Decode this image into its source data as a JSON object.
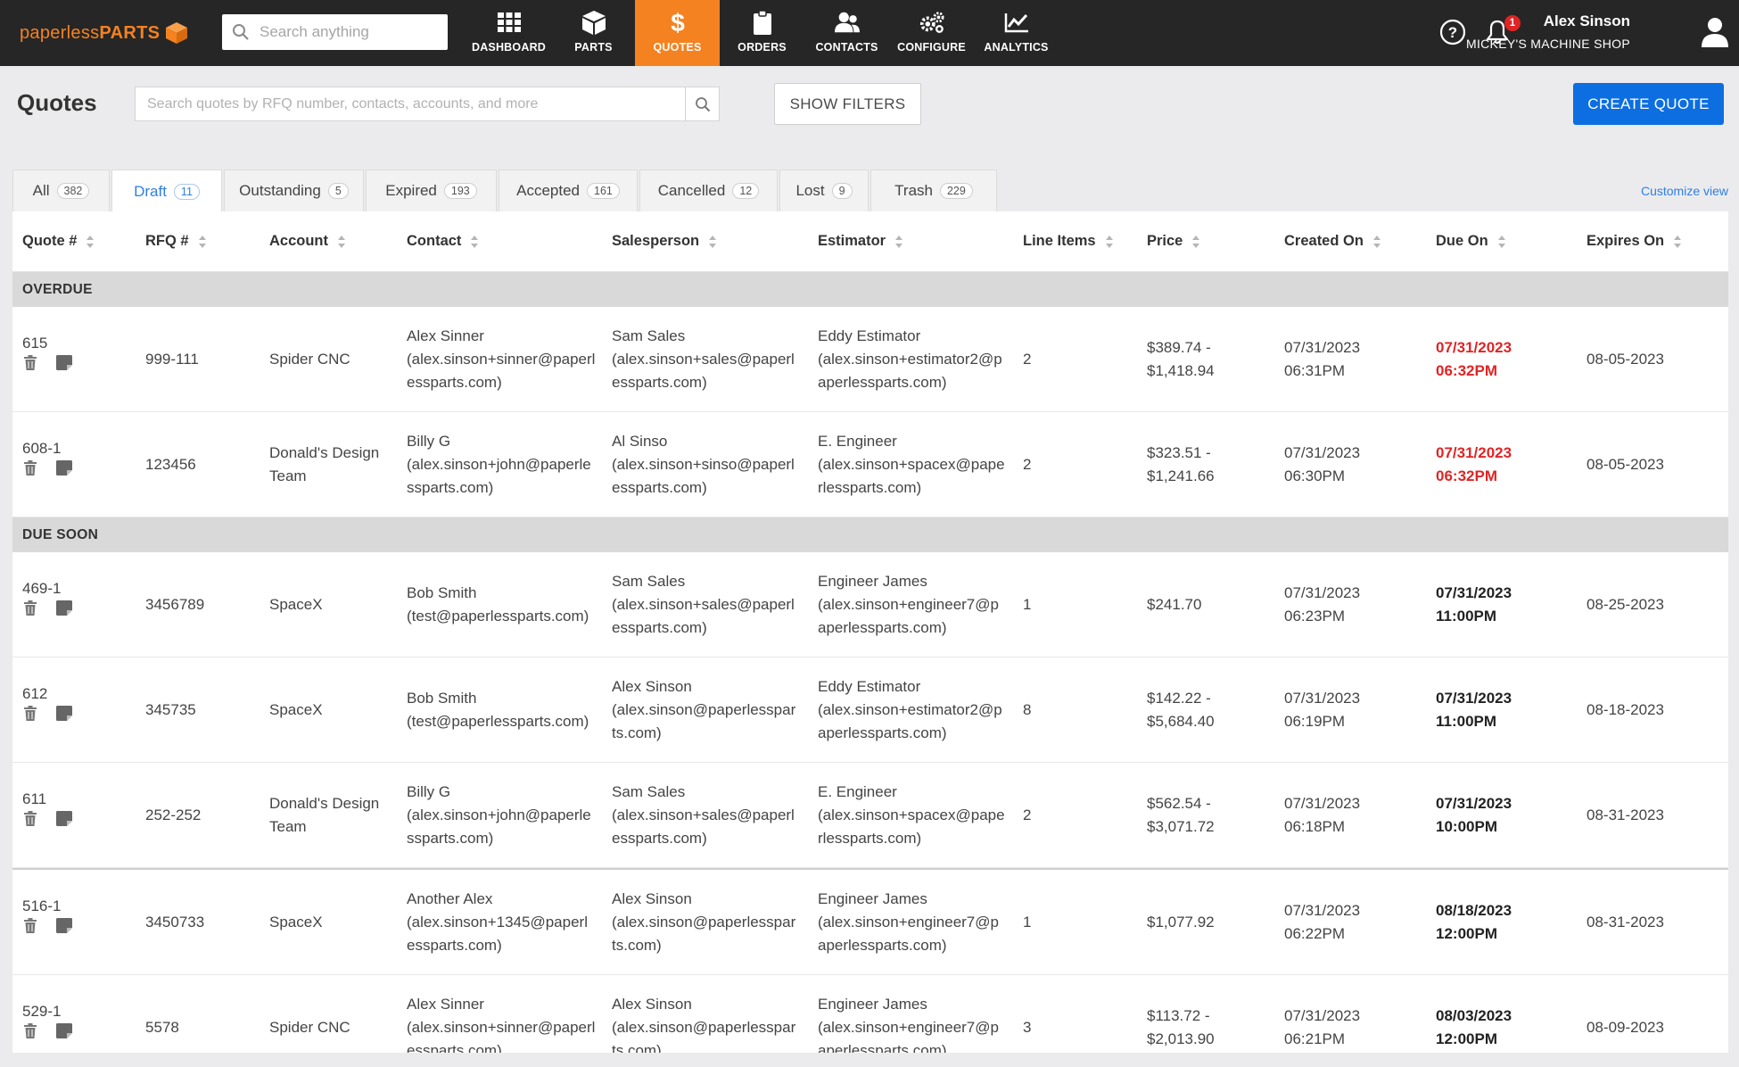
{
  "brand": {
    "name_light": "paperless",
    "name_bold": "PARTS",
    "accent": "#f58220"
  },
  "global_search": {
    "placeholder": "Search anything"
  },
  "nav": [
    {
      "key": "dashboard",
      "label": "DASHBOARD",
      "icon": "dashboard-grid-icon"
    },
    {
      "key": "parts",
      "label": "PARTS",
      "icon": "box-icon"
    },
    {
      "key": "quotes",
      "label": "QUOTES",
      "icon": "dollar-icon",
      "active": true
    },
    {
      "key": "orders",
      "label": "ORDERS",
      "icon": "clipboard-icon"
    },
    {
      "key": "contacts",
      "label": "CONTACTS",
      "icon": "people-icon"
    },
    {
      "key": "configure",
      "label": "CONFIGURE",
      "icon": "gears-icon"
    },
    {
      "key": "analytics",
      "label": "ANALYTICS",
      "icon": "line-chart-icon"
    }
  ],
  "notifications": {
    "count": "1"
  },
  "user": {
    "name": "Alex Sinson",
    "shop": "MICKEY'S MACHINE SHOP"
  },
  "page": {
    "title": "Quotes",
    "search_placeholder": "Search quotes by RFQ number, contacts, accounts, and more",
    "show_filters_label": "SHOW FILTERS",
    "create_quote_label": "CREATE QUOTE"
  },
  "tabs": [
    {
      "label": "All",
      "count": "382"
    },
    {
      "label": "Draft",
      "count": "11",
      "active": true
    },
    {
      "label": "Outstanding",
      "count": "5"
    },
    {
      "label": "Expired",
      "count": "193"
    },
    {
      "label": "Accepted",
      "count": "161"
    },
    {
      "label": "Cancelled",
      "count": "12"
    },
    {
      "label": "Lost",
      "count": "9"
    },
    {
      "label": "Trash",
      "count": "229"
    }
  ],
  "customize_view_label": "Customize view",
  "columns": {
    "quote": "Quote #",
    "rfq": "RFQ #",
    "account": "Account",
    "contact": "Contact",
    "salesperson": "Salesperson",
    "estimator": "Estimator",
    "line_items": "Line Items",
    "price": "Price",
    "created_on": "Created On",
    "due_on": "Due On",
    "expires_on": "Expires On"
  },
  "groups": {
    "overdue": "OVERDUE",
    "due_soon": "DUE SOON"
  },
  "rows": [
    {
      "quote": "615",
      "rfq": "999-111",
      "account": [
        "Spider CNC"
      ],
      "contact": [
        "Alex Sinner",
        "(alex.sinson+sinner@paperl",
        "essparts.com)"
      ],
      "salesperson": [
        "Sam Sales",
        "(alex.sinson+sales@paperl",
        "essparts.com)"
      ],
      "estimator": [
        "Eddy Estimator",
        "(alex.sinson+estimator2@p",
        "aperlessparts.com)"
      ],
      "line_items": "2",
      "price": [
        "$389.74 -",
        "$1,418.94"
      ],
      "created": [
        "07/31/2023",
        "06:31PM"
      ],
      "due": [
        "07/31/2023",
        "06:32PM"
      ],
      "due_style": "red",
      "expires": "08-05-2023"
    },
    {
      "quote": "608-1",
      "rfq": "123456",
      "account": [
        "Donald's Design",
        "Team"
      ],
      "contact": [
        "Billy G",
        "(alex.sinson+john@paperle",
        "ssparts.com)"
      ],
      "salesperson": [
        "Al Sinso",
        "(alex.sinson+sinso@paperl",
        "essparts.com)"
      ],
      "estimator": [
        "E. Engineer",
        "(alex.sinson+spacex@pape",
        "rlessparts.com)"
      ],
      "line_items": "2",
      "price": [
        "$323.51 -",
        "$1,241.66"
      ],
      "created": [
        "07/31/2023",
        "06:30PM"
      ],
      "due": [
        "07/31/2023",
        "06:32PM"
      ],
      "due_style": "red",
      "expires": "08-05-2023"
    },
    {
      "quote": "469-1",
      "rfq": "3456789",
      "account": [
        "SpaceX"
      ],
      "contact": [
        "Bob Smith",
        "(test@paperlessparts.com)"
      ],
      "salesperson": [
        "Sam Sales",
        "(alex.sinson+sales@paperl",
        "essparts.com)"
      ],
      "estimator": [
        "Engineer James",
        "(alex.sinson+engineer7@p",
        "aperlessparts.com)"
      ],
      "line_items": "1",
      "price": [
        "$241.70"
      ],
      "created": [
        "07/31/2023",
        "06:23PM"
      ],
      "due": [
        "07/31/2023",
        "11:00PM"
      ],
      "due_style": "bold",
      "expires": "08-25-2023"
    },
    {
      "quote": "612",
      "rfq": "345735",
      "account": [
        "SpaceX"
      ],
      "contact": [
        "Bob Smith",
        "(test@paperlessparts.com)"
      ],
      "salesperson": [
        "Alex Sinson",
        "(alex.sinson@paperlesspar",
        "ts.com)"
      ],
      "estimator": [
        "Eddy Estimator",
        "(alex.sinson+estimator2@p",
        "aperlessparts.com)"
      ],
      "line_items": "8",
      "price": [
        "$142.22 -",
        "$5,684.40"
      ],
      "created": [
        "07/31/2023",
        "06:19PM"
      ],
      "due": [
        "07/31/2023",
        "11:00PM"
      ],
      "due_style": "bold",
      "expires": "08-18-2023"
    },
    {
      "quote": "611",
      "rfq": "252-252",
      "account": [
        "Donald's Design",
        "Team"
      ],
      "contact": [
        "Billy G",
        "(alex.sinson+john@paperle",
        "ssparts.com)"
      ],
      "salesperson": [
        "Sam Sales",
        "(alex.sinson+sales@paperl",
        "essparts.com)"
      ],
      "estimator": [
        "E. Engineer",
        "(alex.sinson+spacex@pape",
        "rlessparts.com)"
      ],
      "line_items": "2",
      "price": [
        "$562.54 -",
        "$3,071.72"
      ],
      "created": [
        "07/31/2023",
        "06:18PM"
      ],
      "due": [
        "07/31/2023",
        "10:00PM"
      ],
      "due_style": "bold",
      "expires": "08-31-2023"
    },
    {
      "quote": "516-1",
      "rfq": "3450733",
      "account": [
        "SpaceX"
      ],
      "contact": [
        "Another Alex",
        "(alex.sinson+1345@paperl",
        "essparts.com)"
      ],
      "salesperson": [
        "Alex Sinson",
        "(alex.sinson@paperlesspar",
        "ts.com)"
      ],
      "estimator": [
        "Engineer James",
        "(alex.sinson+engineer7@p",
        "aperlessparts.com)"
      ],
      "line_items": "1",
      "price": [
        "$1,077.92"
      ],
      "created": [
        "07/31/2023",
        "06:22PM"
      ],
      "due": [
        "08/18/2023",
        "12:00PM"
      ],
      "due_style": "bold",
      "expires": "08-31-2023"
    },
    {
      "quote": "529-1",
      "rfq": "5578",
      "account": [
        "Spider CNC"
      ],
      "contact": [
        "Alex Sinner",
        "(alex.sinson+sinner@paperl",
        "essparts.com)"
      ],
      "salesperson": [
        "Alex Sinson",
        "(alex.sinson@paperlesspar",
        "ts.com)"
      ],
      "estimator": [
        "Engineer James",
        "(alex.sinson+engineer7@p",
        "aperlessparts.com)"
      ],
      "line_items": "3",
      "price": [
        "$113.72 -",
        "$2,013.90"
      ],
      "created": [
        "07/31/2023",
        "06:21PM"
      ],
      "due": [
        "08/03/2023",
        "12:00PM"
      ],
      "due_style": "bold",
      "expires": "08-09-2023"
    }
  ]
}
